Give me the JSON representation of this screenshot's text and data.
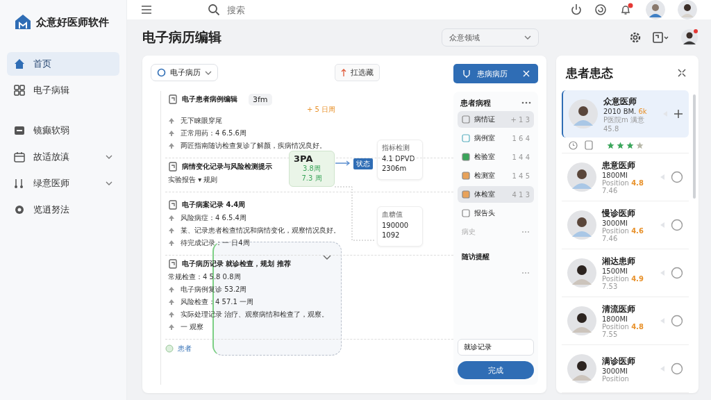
{
  "brand": {
    "title": "众意好医师软件"
  },
  "sidebar": {
    "items": [
      {
        "label": "首页",
        "selected": true,
        "expandable": false
      },
      {
        "label": "电子病辑",
        "selected": false,
        "expandable": false
      },
      {
        "label": "镜癫软弱",
        "selected": false,
        "expandable": false
      },
      {
        "label": "故适放滇",
        "selected": false,
        "expandable": true
      },
      {
        "label": "绿意医师",
        "selected": false,
        "expandable": true
      },
      {
        "label": "览逍努法",
        "selected": false,
        "expandable": false
      }
    ]
  },
  "topbar": {
    "search": {
      "placeholder": "搜索"
    },
    "notification": true
  },
  "page": {
    "title": "电子病历编辑",
    "filter": "众意领域"
  },
  "toolbar": {
    "record_select": "电子病历",
    "sort_button": "扛选藏"
  },
  "timeline": {
    "groups": [
      {
        "title": "电子患者病例编辑",
        "chip": "3fm",
        "note": "+ 5 日周",
        "lines": [
          "无下睐眼穿尾",
          "正常用药：4 6.5.6周",
          "两匠指南随访检查复诊了解颜，疾病情况良好。"
        ]
      },
      {
        "title": "病情变化记录与风险检测提示",
        "sub": "实验报告 ▾ 规则"
      },
      {
        "title": "电子病案记录 4.4周",
        "lines": [
          "风险病症：4 6.5.4周",
          "某、记录患者检查情况和病情变化，观察情况良好。",
          "待完成记录：一 日4周"
        ]
      },
      {
        "title": "电子病历记录 就诊检查，规划 推荐",
        "sub": "常规检查：4 5.8 0.8周",
        "lines": [
          "电子病例复诊 53.2周",
          "风险检查：4 57.1 一周",
          "实际处理记录 治疗、观察病情和检查了，观察。",
          "一 观察"
        ]
      }
    ],
    "footer": "患者"
  },
  "diagram": {
    "node": {
      "value": "3PA",
      "lines": [
        "3.8周",
        "7.3 周"
      ]
    },
    "tag": "状态",
    "cards": [
      {
        "title": "指标检测",
        "lines": [
          "4.1 DPVD",
          "2306m"
        ]
      },
      {
        "title": "血糖值",
        "lines": [
          "190000",
          "1092"
        ]
      }
    ]
  },
  "record_tab": {
    "label": "患病病历"
  },
  "course": {
    "title": "患者病程",
    "items": [
      {
        "label": "病情证",
        "value": "+ 1 3",
        "selected": true
      },
      {
        "label": "病例室",
        "value": "1 6 4",
        "selected": false
      },
      {
        "label": "检验室",
        "value": "1 4 4",
        "selected": false
      },
      {
        "label": "检测室",
        "value": "1 4 5",
        "selected": false
      },
      {
        "label": "体检室",
        "value": "4 1 3",
        "selected": true
      },
      {
        "label": "报告头",
        "selected": false
      }
    ],
    "more_label": "病史",
    "section": "随访提醒",
    "input": {
      "value": "就诊记录"
    },
    "submit": "完成"
  },
  "patients": {
    "title": "患者患态",
    "items": [
      {
        "name": "众意医师",
        "line1": "2010 BM.",
        "badge": "6k",
        "line2": "P医院m 满意45.8",
        "selected": true,
        "stars": 3
      },
      {
        "name": "患意医师",
        "line1": "1800MI",
        "line2": "Position",
        "rating": "4.8",
        "score": "7.46",
        "selected": false
      },
      {
        "name": "慢诊医师",
        "line1": "3000MI",
        "line2": "Position",
        "rating": "4.6",
        "score": "7.46",
        "selected": false
      },
      {
        "name": "湘达患师",
        "line1": "1500MI",
        "line2": "Position",
        "rating": "4.9",
        "score": "7.53",
        "selected": false
      },
      {
        "name": "清流医师",
        "line1": "1800MI",
        "line2": "Position",
        "rating": "4.8",
        "score": "7.55",
        "selected": false
      },
      {
        "name": "满诊医师",
        "line1": "3000MI",
        "line2": "Position",
        "selected": false
      }
    ]
  }
}
